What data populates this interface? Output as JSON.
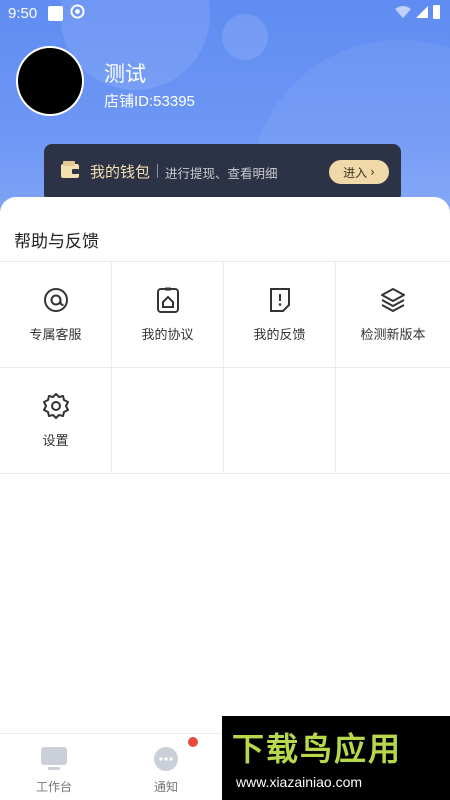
{
  "status_bar": {
    "time": "9:50"
  },
  "profile": {
    "name": "测试",
    "shop_id": "店铺ID:53395"
  },
  "wallet": {
    "title": "我的钱包",
    "subtitle": "进行提现、查看明细",
    "enter_label": "进入",
    "enter_chevron": "›"
  },
  "help": {
    "title": "帮助与反馈",
    "items": [
      {
        "label": "专属客服",
        "icon": "at-icon"
      },
      {
        "label": "我的协议",
        "icon": "agreement-icon"
      },
      {
        "label": "我的反馈",
        "icon": "feedback-icon"
      },
      {
        "label": "检测新版本",
        "icon": "layers-icon"
      },
      {
        "label": "设置",
        "icon": "gear-icon"
      }
    ]
  },
  "tabbar": {
    "items": [
      {
        "label": "工作台",
        "icon": "monitor-icon"
      },
      {
        "label": "通知",
        "icon": "chat-bubble-icon"
      }
    ]
  },
  "watermark": {
    "title": "下载鸟应用",
    "url": "www.xiazainiao.com"
  },
  "colors": {
    "header": "#6f98f5",
    "wallet_bg": "#2d3346",
    "wallet_accent": "#f3dfb0",
    "badge": "#e64b3c"
  }
}
